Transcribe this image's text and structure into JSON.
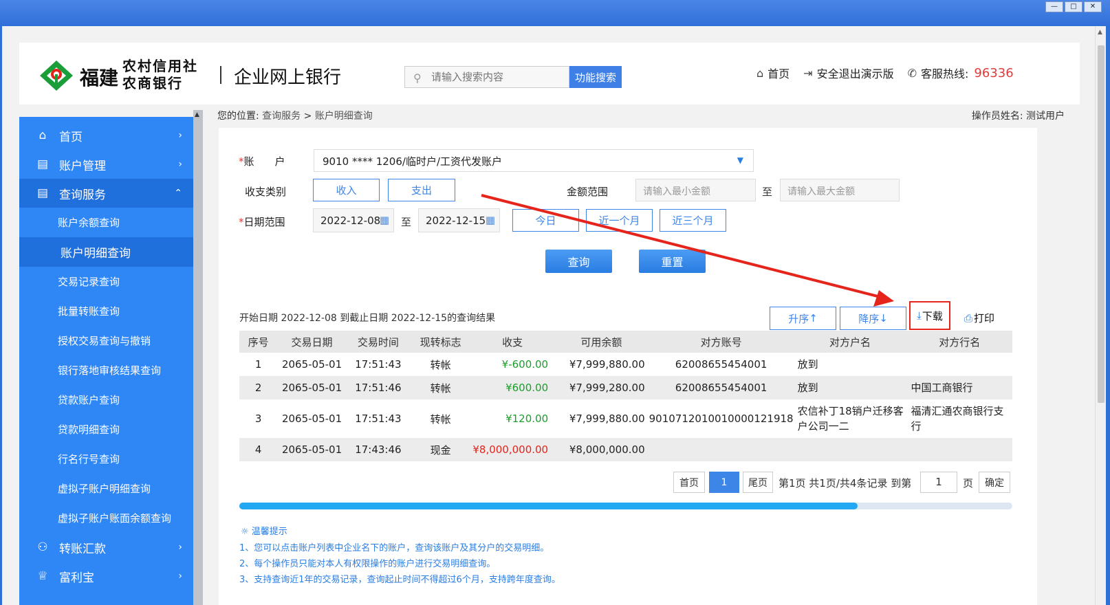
{
  "window": {
    "controls": [
      "—",
      "□",
      "✕"
    ]
  },
  "header": {
    "brand_province": "福建",
    "brand_name": "农村信用社 农商银行",
    "title": "企业网上银行",
    "search": {
      "placeholder": "请输入搜索内容",
      "button": "功能搜索"
    },
    "links": {
      "home": "首页",
      "logout": "安全退出演示版",
      "hotline_label": "客服热线:",
      "hotline_number": "96336"
    }
  },
  "sidebar": {
    "items": [
      {
        "icon": "home-icon",
        "label": "首页"
      },
      {
        "icon": "account-icon",
        "label": "账户管理"
      },
      {
        "icon": "query-icon",
        "label": "查询服务"
      }
    ],
    "sub_items": [
      "账户余额查询",
      "账户明细查询",
      "交易记录查询",
      "批量转账查询",
      "授权交易查询与撤销",
      "银行落地审核结果查询",
      "贷款账户查询",
      "贷款明细查询",
      "行名行号查询",
      "虚拟子账户明细查询",
      "虚拟子账户账面余额查询"
    ],
    "bottom_items": [
      {
        "icon": "transfer-icon",
        "label": "转账汇款"
      },
      {
        "icon": "wealth-icon",
        "label": "富利宝"
      }
    ]
  },
  "breadcrumb": {
    "prefix": "您的位置:",
    "level1": "查询服务",
    "sep": ">",
    "level2": "账户明细查询"
  },
  "operator": "操作员姓名: 测试用户",
  "form": {
    "account_label": "账　　户",
    "account_value": "9010 **** 1206/临时户/工资代发账户",
    "type_label": "收支类别",
    "type_income": "收入",
    "type_expense": "支出",
    "amount_label": "金额范围",
    "amount_min_placeholder": "请输入最小金额",
    "amount_to": "至",
    "amount_max_placeholder": "请输入最大金额",
    "date_label": "日期范围",
    "date_start": "2022-12-08",
    "date_to": "至",
    "date_end": "2022-12-15",
    "today": "今日",
    "last_month": "近一个月",
    "last_3_months": "近三个月",
    "query": "查询",
    "reset": "重置"
  },
  "results": {
    "title": "开始日期 2022-12-08 到截止日期 2022-12-15的查询结果",
    "asc": "升序",
    "desc": "降序",
    "download": "下载",
    "print": "打印",
    "columns": [
      "序号",
      "交易日期",
      "交易时间",
      "现转标志",
      "收支",
      "可用余额",
      "对方账号",
      "对方户名",
      "对方行名"
    ],
    "rows": [
      {
        "no": "1",
        "date": "2065-05-01",
        "time": "17:51:43",
        "flag": "转帐",
        "amount": "¥-600.00",
        "amount_color": "green",
        "balance": "¥7,999,880.00",
        "acct": "62008655454001",
        "name": "放到",
        "bank": ""
      },
      {
        "no": "2",
        "date": "2065-05-01",
        "time": "17:51:46",
        "flag": "转帐",
        "amount": "¥600.00",
        "amount_color": "green",
        "balance": "¥7,999,280.00",
        "acct": "62008655454001",
        "name": "放到",
        "bank": "中国工商银行"
      },
      {
        "no": "3",
        "date": "2065-05-01",
        "time": "17:51:43",
        "flag": "转帐",
        "amount": "¥120.00",
        "amount_color": "green",
        "balance": "¥7,999,880.00",
        "acct": "9010712010010000121918",
        "name": "农信补丁18销户迁移客户公司一二",
        "bank": "福清汇通农商银行支行"
      },
      {
        "no": "4",
        "date": "2065-05-01",
        "time": "17:43:46",
        "flag": "现金",
        "amount": "¥8,000,000.00",
        "amount_color": "red",
        "balance": "¥8,000,000.00",
        "acct": "",
        "name": "",
        "bank": ""
      }
    ]
  },
  "pagination": {
    "first": "首页",
    "current": "1",
    "last": "尾页",
    "info": "第1页 共1页/共4条记录 到第",
    "goto_value": "1",
    "page_unit": "页",
    "confirm": "确定"
  },
  "scroll_progress": 0.8,
  "tips": {
    "title": "温馨提示",
    "items": [
      "1、您可以点击账户列表中企业名下的账户，查询该账户及其分户的交易明细。",
      "2、每个操作员只能对本人有权限操作的账户进行交易明细查询。",
      "3、支持查询近1年的交易记录，查询起止时间不得超过6个月，支持跨年度查询。"
    ]
  },
  "colors": {
    "accent": "#3d86e8",
    "sidebar": "#2f86f5",
    "annotation": "#e5241b",
    "positive": "#1a9e2a",
    "negative": "#e5241b"
  }
}
